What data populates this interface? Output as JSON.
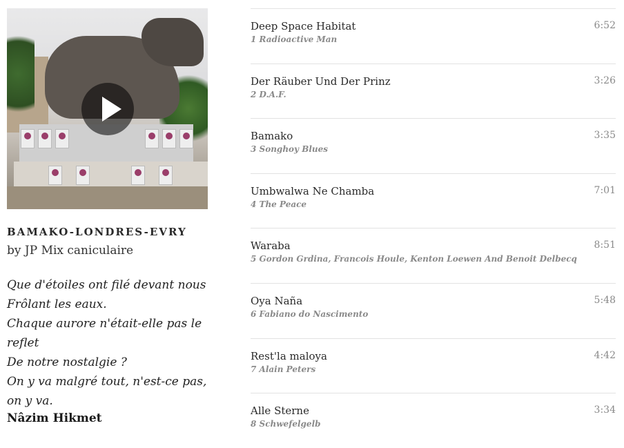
{
  "album": {
    "title": "BAMAKO-LONDRES-EVRY",
    "by_prefix": "by",
    "by_name": "JP Mix caniculaire",
    "cover_icon": "play-icon"
  },
  "poem": {
    "lines": [
      "Que d'étoiles ont filé devant nous",
      "Frôlant les eaux.",
      "Chaque aurore n'était-elle pas le",
      "reflet",
      "De notre nostalgie ?",
      "On y va malgré tout, n'est-ce pas,",
      "on y va."
    ],
    "author": "Nâzim Hikmet"
  },
  "tracks": [
    {
      "title": "Deep Space Habitat",
      "number_artist": "1 Radioactive Man",
      "duration": "6:52"
    },
    {
      "title": "Der Räuber Und Der Prinz",
      "number_artist": "2 D.A.F.",
      "duration": "3:26"
    },
    {
      "title": "Bamako",
      "number_artist": "3 Songhoy Blues",
      "duration": "3:35"
    },
    {
      "title": "Umbwalwa Ne Chamba",
      "number_artist": "4 The Peace",
      "duration": "7:01"
    },
    {
      "title": "Waraba",
      "number_artist": "5 Gordon Grdina, Francois Houle, Kenton Loewen And Benoit Delbecq",
      "duration": "8:51"
    },
    {
      "title": "Oya Naña",
      "number_artist": "6 Fabiano do Nascimento",
      "duration": "5:48"
    },
    {
      "title": "Rest'la maloya",
      "number_artist": "7 Alain Peters",
      "duration": "4:42"
    },
    {
      "title": "Alle Sterne",
      "number_artist": "8 Schwefelgelb",
      "duration": "3:34"
    }
  ]
}
